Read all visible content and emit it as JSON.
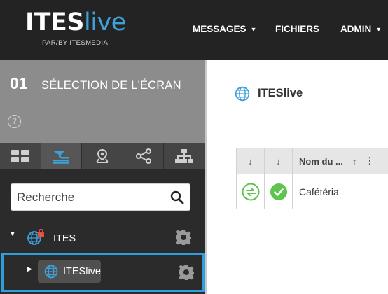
{
  "header": {
    "logo_main": "ITES",
    "logo_accent": "live",
    "logo_sub": "PAR/BY ITESMEDIA",
    "nav": [
      {
        "label": "MESSAGES",
        "caret": "▼"
      },
      {
        "label": "FICHIERS",
        "caret": ""
      },
      {
        "label": "ADMIN",
        "caret": "▼"
      }
    ]
  },
  "sidebar": {
    "step_number": "01",
    "step_title": "SÉLECTION DE L'ÉCRAN",
    "help": "?",
    "tabs": [
      "grid-icon",
      "list-filter-icon",
      "map-pin-icon",
      "share-icon",
      "hierarchy-icon"
    ],
    "search": {
      "placeholder": "Recherche",
      "value": ""
    },
    "tree": [
      {
        "label": "ITES",
        "icon": "globe-lock-icon",
        "expanded": true
      },
      {
        "label": "ITESlive",
        "icon": "globe-icon",
        "expanded": false,
        "selected": true
      }
    ]
  },
  "main": {
    "title": "ITESlive",
    "grid": {
      "headers": {
        "col1": "↓",
        "col2": "↓",
        "col3": "Nom du ...",
        "sort": "↑",
        "menu": "⋮"
      },
      "rows": [
        {
          "col3": "Cafétéria",
          "sync_status": "sync-icon",
          "online_status": "check-icon"
        }
      ]
    }
  },
  "colors": {
    "accent": "#3ea0d8",
    "header_bg": "#232323",
    "sidebar_bg": "#2b2b2b",
    "selection": "#2e9fdc",
    "success": "#5ec44e"
  }
}
